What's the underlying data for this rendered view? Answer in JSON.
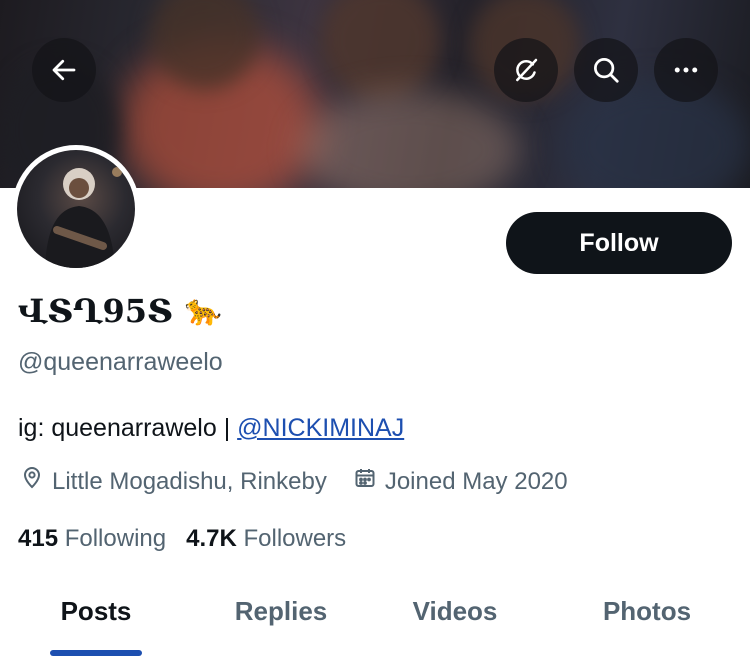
{
  "profile": {
    "display_name": "ՎՏՂ95Տ",
    "name_emoji": "🐆",
    "handle": "@queenarraweelo",
    "bio_text": "ig: queenarrawelo | ",
    "bio_mention": "@NICKIMINAJ",
    "location": "Little Mogadishu, Rinkeby",
    "joined": "Joined May 2020",
    "following_count": "415",
    "following_label": "Following",
    "followers_count": "4.7K",
    "followers_label": "Followers"
  },
  "follow_button": {
    "label": "Follow"
  },
  "tabs": [
    {
      "label": "Posts",
      "active": true
    },
    {
      "label": "Replies",
      "active": false
    },
    {
      "label": "Videos",
      "active": false
    },
    {
      "label": "Photos",
      "active": false
    }
  ],
  "icons": {
    "back": "back-arrow-icon",
    "grok": "grok-icon",
    "search": "search-icon",
    "more": "more-icon",
    "location": "location-pin-icon",
    "calendar": "calendar-icon"
  },
  "colors": {
    "text_primary": "#0f1419",
    "text_secondary": "#536471",
    "link": "#1d4fb0",
    "follow_bg": "#0f1419",
    "tab_indicator": "#1d4fb0"
  }
}
